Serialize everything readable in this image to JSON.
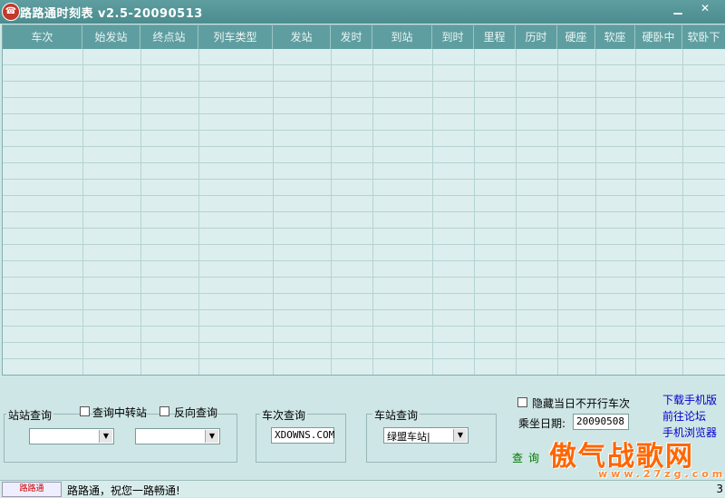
{
  "window": {
    "title": "路路通时刻表 v2.5-20090513",
    "icon_text": "☎",
    "minimize": "▁",
    "close": "✕"
  },
  "table": {
    "columns": [
      "车次",
      "始发站",
      "终点站",
      "列车类型",
      "发站",
      "发时",
      "到站",
      "到时",
      "里程",
      "历时",
      "硬座",
      "软座",
      "硬卧中",
      "软卧下"
    ],
    "rows": []
  },
  "station_query": {
    "title": "站站查询",
    "transfer_label": "查询中转站",
    "reverse_label": "反向查询",
    "from_value": "",
    "to_value": ""
  },
  "train_query": {
    "title": "车次查询",
    "value": "XDOWNS.COM"
  },
  "station_lookup": {
    "title": "车站查询",
    "value": "绿盟车站|"
  },
  "options": {
    "hide_label": "隐藏当日不开行车次",
    "date_label": "乘坐日期:",
    "date_value": "20090508",
    "query_button": "查询"
  },
  "links": {
    "download": "下载手机版",
    "forum": "前往论坛",
    "browser": "手机浏览器"
  },
  "watermark": {
    "main": "傲气战歌网",
    "sub": "www.27zg.com"
  },
  "status": {
    "logo": "路路通",
    "text": "路路通，祝您一路畅通!",
    "right": "3"
  },
  "colors": {
    "header": "#5f9ea0",
    "background": "#cfe6e6"
  }
}
